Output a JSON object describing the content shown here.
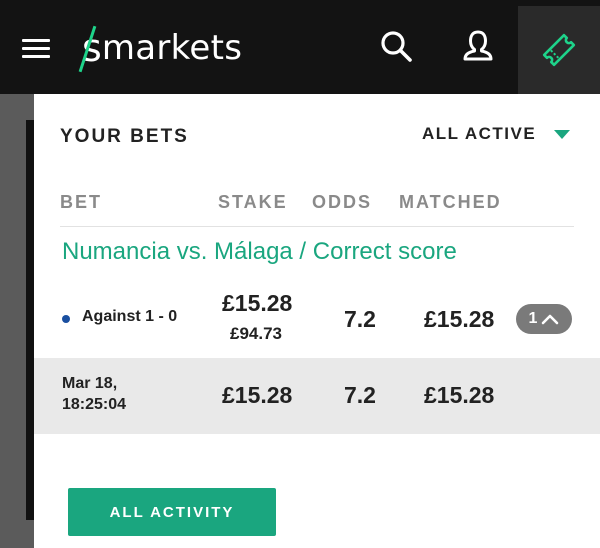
{
  "header": {
    "logo_initial": "s",
    "logo_text": "markets",
    "icons": [
      "menu-icon",
      "search-icon",
      "account-icon",
      "betslip-ticket-icon"
    ],
    "accent_color": "#1ed38a"
  },
  "panel": {
    "title": "YOUR BETS",
    "filter_label": "ALL ACTIVE",
    "columns": {
      "bet": "BET",
      "stake": "STAKE",
      "odds": "ODDS",
      "matched": "MATCHED"
    },
    "market": "Numancia vs. Málaga / Correct score",
    "bet": {
      "selection": "Against 1 - 0",
      "stake": "£15.28",
      "liability": "£94.73",
      "odds": "7.2",
      "matched": "£15.28",
      "count": "1"
    },
    "history": {
      "date": "Mar 18,",
      "time": "18:25:04",
      "stake": "£15.28",
      "odds": "7.2",
      "matched": "£15.28"
    },
    "activity_button": "ALL ACTIVITY"
  },
  "colors": {
    "brand_green": "#1aa67f",
    "topbar": "#131313",
    "back_dot": "#1a4fa0"
  }
}
